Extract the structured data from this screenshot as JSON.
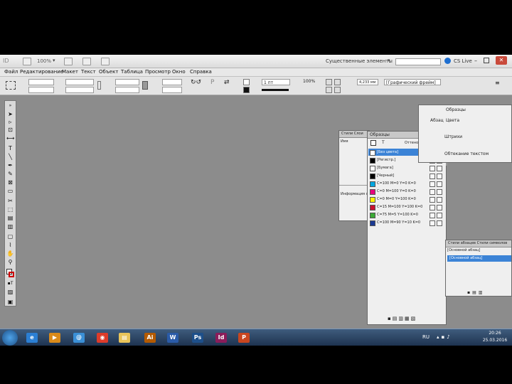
{
  "app": {
    "logo": "ID",
    "zoom": "100%",
    "workspace": "Существенные элементы",
    "cslive": "CS Live"
  },
  "menu": [
    "Файл",
    "Редактирование",
    "Макет",
    "Текст",
    "Объект",
    "Таблица",
    "Просмотр",
    "Окно",
    "Справка"
  ],
  "control": {
    "stroke_weight": "1 пт",
    "scale": "100%",
    "measure": "4,233 мм",
    "frame_style": "[Графический фрейм]"
  },
  "panel_styles": {
    "tabs": [
      "Стили",
      "Слои"
    ],
    "first_row": "Имя",
    "info_row": "Информация о"
  },
  "panel_swatches": {
    "title": "Образцы",
    "tint_label": "Оттенок",
    "tint_value": "%",
    "rows": [
      {
        "label": "[Без цвета]",
        "color": "#ffffff",
        "selected": true
      },
      {
        "label": "[Регистр.]",
        "color": "#000000"
      },
      {
        "label": "[Бумага]",
        "color": "#ffffff"
      },
      {
        "label": "[Черный]",
        "color": "#000000"
      },
      {
        "label": "C=100 M=0 Y=0 K=0",
        "color": "#00a6e0"
      },
      {
        "label": "C=0 M=100 Y=0 K=0",
        "color": "#e8007d"
      },
      {
        "label": "C=0 M=0 Y=100 K=0",
        "color": "#fff200"
      },
      {
        "label": "C=15 M=100 Y=100 K=0",
        "color": "#c8102e"
      },
      {
        "label": "C=75 M=5 Y=100 K=0",
        "color": "#3aa935"
      },
      {
        "label": "C=100 M=90 Y=10 K=0",
        "color": "#1b3a93"
      }
    ]
  },
  "panel_right": {
    "items": [
      "Образцы",
      "Цвета",
      "Абзац",
      "Штрихи",
      "Обтекание текстом"
    ]
  },
  "panel_para": {
    "tabs": [
      "Стили абзацев",
      "Стили символов"
    ],
    "header": "[Основной абзац]",
    "row": "[Основной абзац]"
  },
  "taskbar": {
    "lang": "RU",
    "time": "20:26",
    "date": "25.03.2016",
    "apps": [
      {
        "name": "ie",
        "color": "#2b7fd4",
        "glyph": "e"
      },
      {
        "name": "media",
        "color": "#d98a1a",
        "glyph": "▶"
      },
      {
        "name": "qip",
        "color": "#3a8fd6",
        "glyph": "@"
      },
      {
        "name": "chrome",
        "color": "#dd3b2a",
        "glyph": "◉"
      },
      {
        "name": "explorer",
        "color": "#e9c45a",
        "glyph": "▤"
      },
      {
        "name": "illustrator",
        "color": "#b35a00",
        "glyph": "Ai"
      },
      {
        "name": "word",
        "color": "#2a5ba8",
        "glyph": "W"
      },
      {
        "name": "photoshop",
        "color": "#1d4f8a",
        "glyph": "Ps"
      },
      {
        "name": "indesign",
        "color": "#8b1c5a",
        "glyph": "Id"
      },
      {
        "name": "powerpoint",
        "color": "#c9461f",
        "glyph": "P"
      }
    ]
  }
}
